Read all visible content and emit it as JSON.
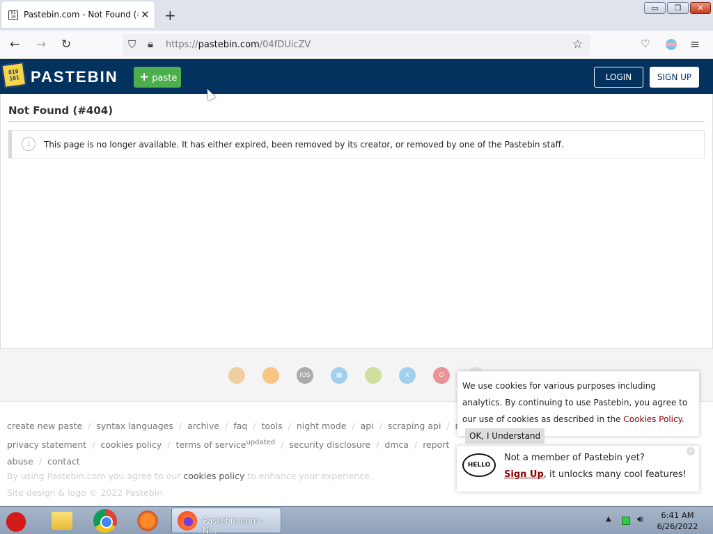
{
  "browser": {
    "tab_title": "Pastebin.com - Not Found (#404)",
    "tab_close": "✕",
    "new_tab": "+",
    "url_prefix": "https://",
    "url_host": "pastebin.com",
    "url_path": "/04fDUicZV",
    "window_min": "▭",
    "window_max": "❐",
    "window_close": "✕"
  },
  "header": {
    "logo_text": "010\n101",
    "brand": "PASTEBIN",
    "paste_label": "paste",
    "login_label": "LOGIN",
    "signup_label": "SIGN UP"
  },
  "main": {
    "title": "Not Found (#404)",
    "notice": "This page is no longer available. It has either expired, been removed by its creator, or removed by one of the Pastebin staff.",
    "notice_icon": "i"
  },
  "platforms": [
    {
      "name": "chrome-icon",
      "color": "#e8a040",
      "text": ""
    },
    {
      "name": "firefox-icon",
      "color": "#ff8a00",
      "text": ""
    },
    {
      "name": "ios-icon",
      "color": "#555555",
      "text": "iOS"
    },
    {
      "name": "windows-icon",
      "color": "#3aa7e8",
      "text": "▦"
    },
    {
      "name": "android-icon",
      "color": "#a4c639",
      "text": ""
    },
    {
      "name": "twitter-x-icon",
      "color": "#3aa7e8",
      "text": "X"
    },
    {
      "name": "opera-icon",
      "color": "#e0202a",
      "text": "O"
    },
    {
      "name": "edge-icon",
      "color": "#cccccc",
      "text": ""
    }
  ],
  "footer": {
    "row1": [
      "create new paste",
      "syntax languages",
      "archive",
      "faq",
      "tools",
      "night mode",
      "api",
      "scraping api",
      "news"
    ],
    "row2": [
      "privacy statement",
      "cookies policy",
      "terms of service",
      "security disclosure",
      "dmca",
      "report abuse",
      "contact"
    ],
    "tos_sup": "updated",
    "note_pre": "By using Pastebin.com you agree to our",
    "note_link": "cookies policy",
    "note_post": "to enhance your experience.",
    "copyright": "Site design & logo © 2022 Pastebin"
  },
  "cookie_popup": {
    "text": "We use cookies for various purposes including analytics. By continuing to use Pastebin, you agree to our use of cookies as described in the",
    "link": "Cookies Policy",
    "period": ".",
    "ok_label": "OK, I Understand"
  },
  "member_popup": {
    "hello": "HELLO",
    "question": "Not a member of Pastebin yet?",
    "signup": "Sign Up",
    "rest": ", it unlocks many cool features!",
    "close": "×"
  },
  "taskbar": {
    "task_label": "Pastebin.com - N...",
    "time": "6:41 AM",
    "date": "6/26/2022"
  }
}
